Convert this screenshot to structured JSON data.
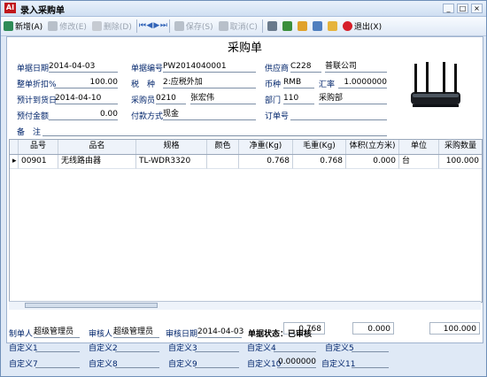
{
  "window": {
    "title": "录入采购单",
    "icon_text": "AI",
    "buttons": [
      "_",
      "□",
      "×"
    ]
  },
  "toolbar": {
    "items": [
      {
        "label": "新增(A)",
        "icon": "add-icon",
        "color": "#2e8b57",
        "disabled": false
      },
      {
        "label": "修改(E)",
        "icon": "edit-icon",
        "color": "#9aa3af",
        "disabled": true
      },
      {
        "label": "删除(D)",
        "icon": "delete-icon",
        "color": "#9aa3af",
        "disabled": true
      },
      {
        "label": "保存(S)",
        "icon": "save-icon",
        "color": "#9aa3af",
        "disabled": true
      },
      {
        "label": "取消(C)",
        "icon": "cancel-icon",
        "color": "#9aa3af",
        "disabled": true
      },
      {
        "label": "退出(X)",
        "icon": "exit-icon",
        "color": "#d61f2a",
        "disabled": false
      }
    ]
  },
  "doc": {
    "title": "采购单"
  },
  "fields": {
    "doc_date_label": "单据日期",
    "doc_date": "2014-04-03",
    "doc_no_label": "单据编号",
    "doc_no": "PW2014040001",
    "supplier_label": "供应商",
    "supplier_code": "C228",
    "supplier_name": "普联公司",
    "discount_label": "整单折扣%",
    "discount": "100.00",
    "tax_label": "税　种",
    "tax_code": "2:应税外加",
    "currency_label": "币种",
    "currency": "RMB",
    "rate_label": "汇率",
    "rate": "1.0000000",
    "delivery_label": "预计到货日",
    "delivery": "2014-04-10",
    "buyer_label": "采购员",
    "buyer_code": "0210",
    "buyer_name": "张宏伟",
    "dept_label": "部门",
    "dept_code": "110",
    "dept_name": "采购部",
    "prepay_label": "预付金额",
    "prepay": "0.00",
    "payment_label": "付款方式",
    "payment": "现金",
    "order_label": "订单号",
    "order": "",
    "remark_label": "备　注",
    "remark": ""
  },
  "table": {
    "columns": [
      "品号",
      "品名",
      "规格",
      "颜色",
      "净重(Kg)",
      "毛重(Kg)",
      "体积(立方米)",
      "单位",
      "采购数量"
    ],
    "rows": [
      [
        "00901",
        "无线路由器",
        "TL-WDR3320",
        "",
        "0.768",
        "0.768",
        "0.000",
        "台",
        "100.000"
      ]
    ],
    "totals": {
      "net": "0.768",
      "volume": "0.000",
      "qty": "100.000"
    }
  },
  "footer": {
    "maker_label": "制单人",
    "maker": "超级管理员",
    "reviewer_label": "审核人",
    "reviewer": "超级管理员",
    "review_date_label": "审核日期",
    "review_date": "2014-04-03",
    "status": "单据状态：已审核",
    "custom_labels": [
      "自定义1",
      "自定义2",
      "自定义3",
      "自定义4",
      "自定义5",
      "自定义7",
      "自定义8",
      "自定义9",
      "自定义10",
      "自定义11"
    ],
    "custom10_value": "0.000000"
  }
}
